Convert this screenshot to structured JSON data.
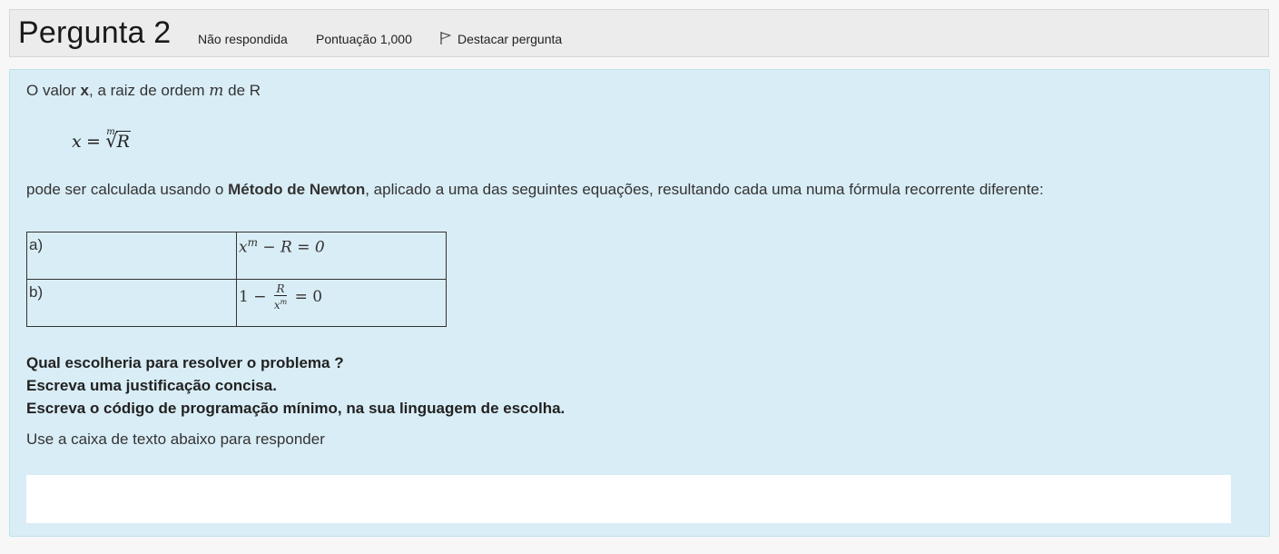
{
  "header": {
    "title": "Pergunta 2",
    "status": "Não respondida",
    "score": "Pontuação 1,000",
    "flag_label": "Destacar pergunta",
    "flag_icon": "flag-outline-icon"
  },
  "question": {
    "intro_prefix": "O valor ",
    "intro_bold": "x",
    "intro_middle": ", a raiz de ordem ",
    "intro_m": "m",
    "intro_suffix": " de R",
    "formula": {
      "lhs": "x",
      "eq": "=",
      "index": "m",
      "radicand": "R"
    },
    "method_prefix": "pode ser calculada usando o ",
    "method_bold": "Método de Newton",
    "method_suffix": ", aplicado a uma das seguintes equações, resultando cada uma numa fórmula recorrente diferente:",
    "options": [
      {
        "label": "a)",
        "eq_base": "x",
        "eq_exp": "m",
        "eq_rest": " − R = 0"
      },
      {
        "label": "b)",
        "eq_prefix": "1 − ",
        "frac_num": "R",
        "frac_den_base": "x",
        "frac_den_exp": "m",
        "eq_suffix": " = 0"
      }
    ],
    "instructions": [
      "Qual escolheria para resolver o problema ?",
      "Escreva uma justificação concisa.",
      "Escreva o código de programação mínimo, na sua linguagem de escolha."
    ],
    "answer_prompt": "Use a caixa de texto abaixo para responder",
    "answer_value": ""
  },
  "colors": {
    "header_bg": "#ececec",
    "body_bg": "#d9edf6",
    "body_border": "#bfe0ee"
  }
}
